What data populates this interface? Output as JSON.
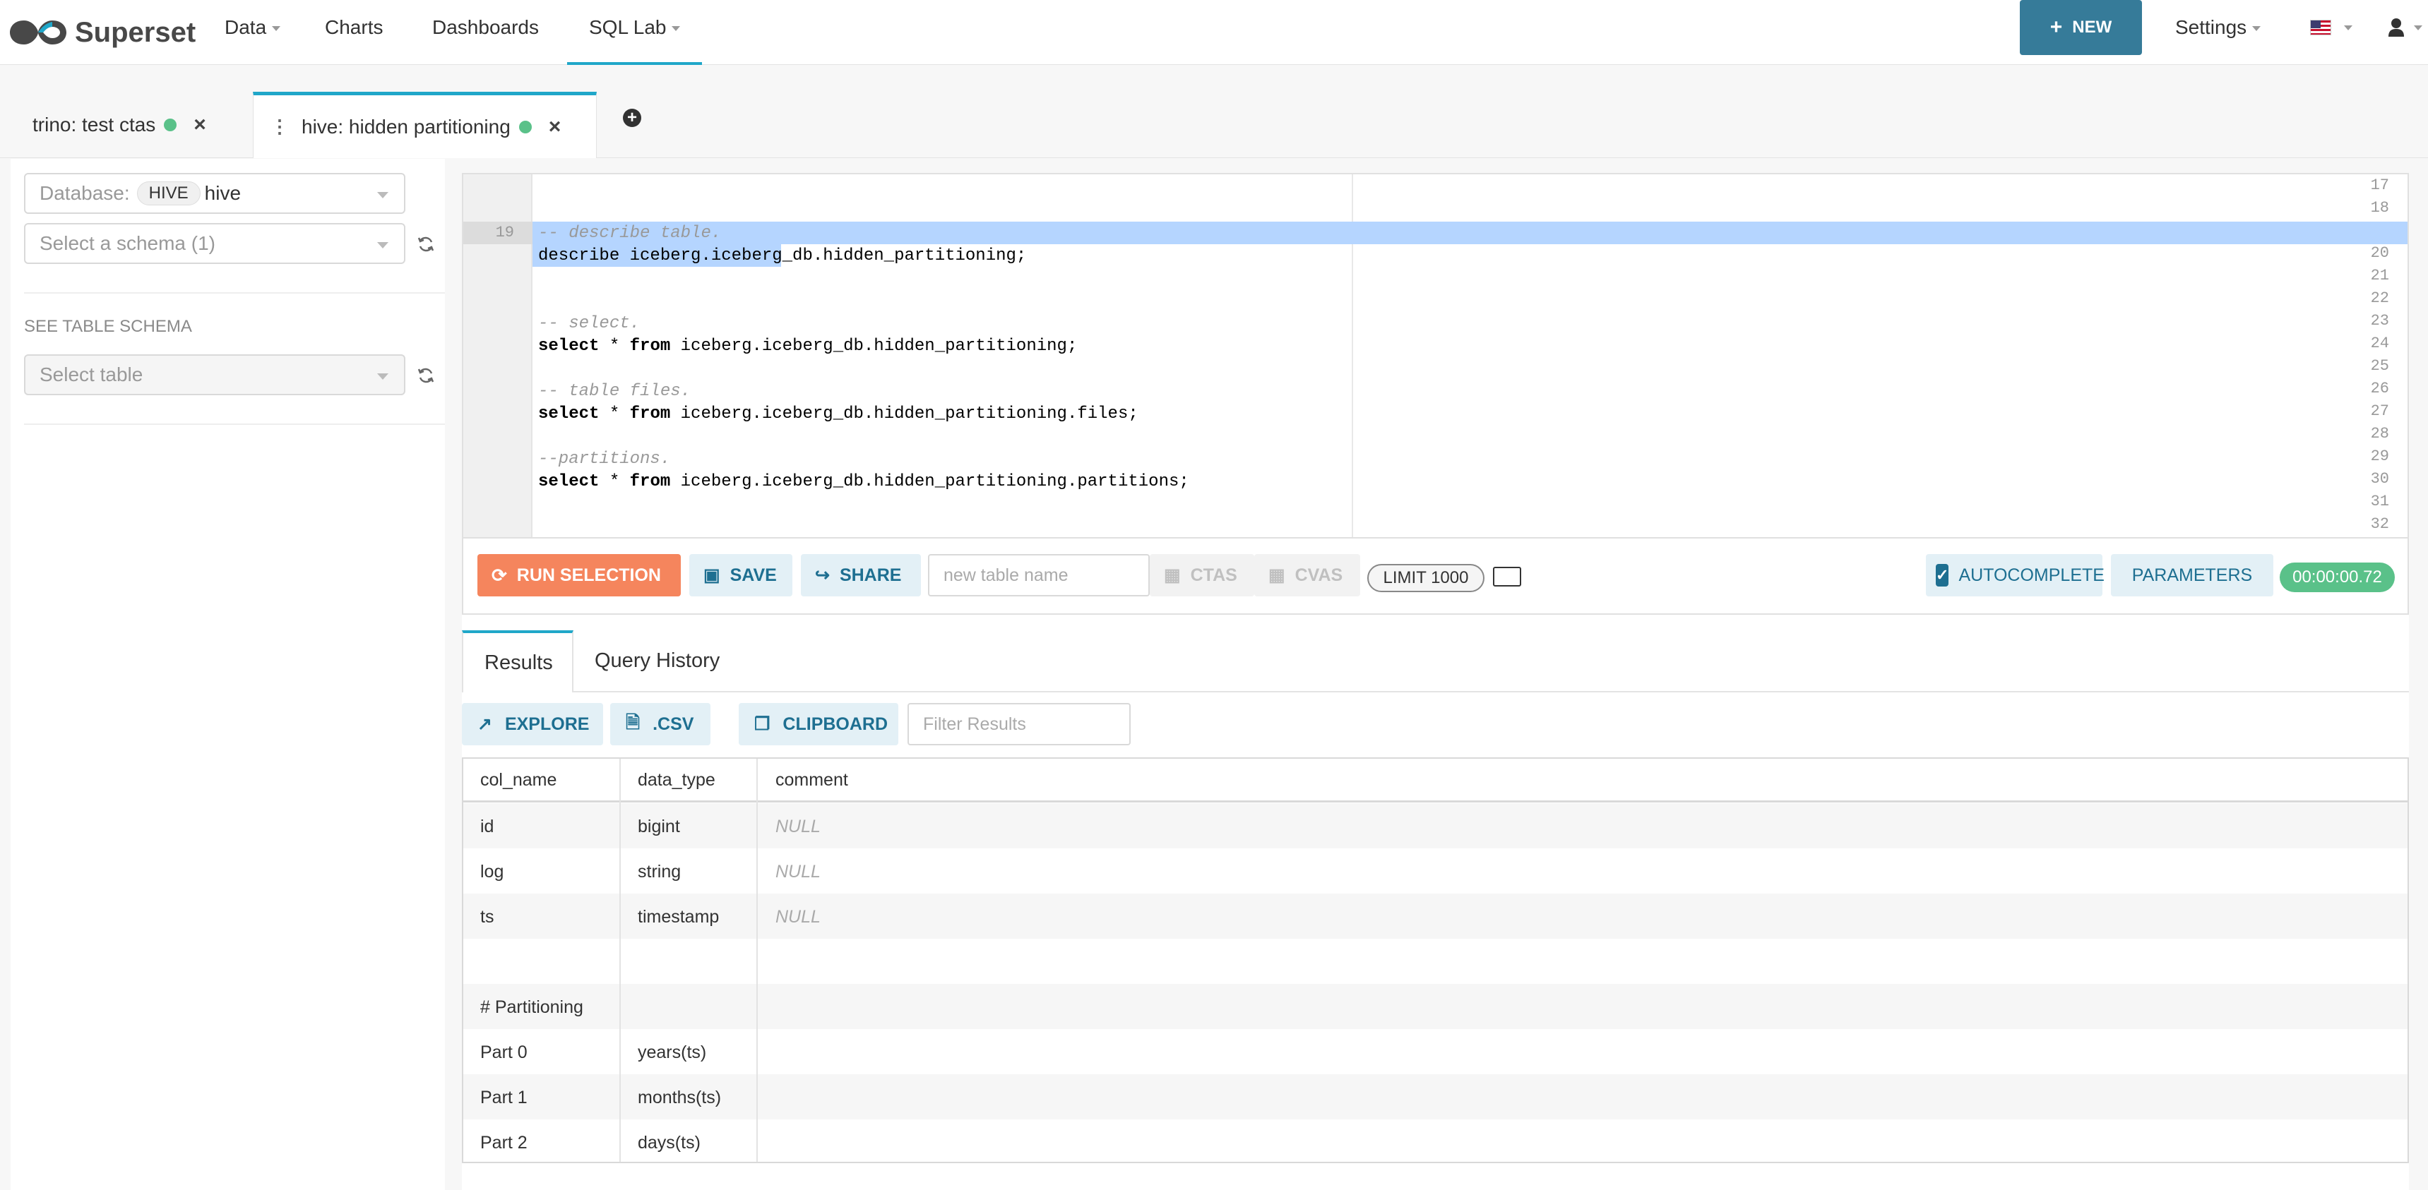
{
  "navbar": {
    "brand": "Superset",
    "items": [
      {
        "label": "Data",
        "dropdown": true
      },
      {
        "label": "Charts",
        "dropdown": false
      },
      {
        "label": "Dashboards",
        "dropdown": false
      },
      {
        "label": "SQL Lab",
        "dropdown": true,
        "active": true
      }
    ],
    "new_button": "NEW",
    "settings": "Settings",
    "language_icon": "us-flag-icon",
    "user_icon": "user-icon"
  },
  "query_tabs": [
    {
      "label": "trino: test ctas",
      "status": "success",
      "active": false
    },
    {
      "label": "hive: hidden partitioning",
      "status": "success",
      "active": true
    }
  ],
  "left_panel": {
    "database_label": "Database:",
    "database_tag": "HIVE",
    "database_value": "hive",
    "schema_placeholder": "Select a schema (1)",
    "section_label": "SEE TABLE SCHEMA",
    "table_placeholder": "Select table"
  },
  "editor": {
    "lines": [
      {
        "num": "17",
        "text": ""
      },
      {
        "num": "18",
        "text": ""
      },
      {
        "num": "19",
        "text": "-- describe table."
      },
      {
        "num": "20",
        "text": "describe iceberg.iceberg_db.hidden_partitioning;"
      },
      {
        "num": "21",
        "text": ""
      },
      {
        "num": "22",
        "text": ""
      },
      {
        "num": "23",
        "text": "-- select."
      },
      {
        "num": "24",
        "kw1": "select",
        "mid": " * ",
        "kw2": "from",
        "rest": " iceberg.iceberg_db.hidden_partitioning;"
      },
      {
        "num": "25",
        "text": ""
      },
      {
        "num": "26",
        "text": "-- table files."
      },
      {
        "num": "27",
        "kw1": "select",
        "mid": " * ",
        "kw2": "from",
        "rest": " iceberg.iceberg_db.hidden_partitioning.files;"
      },
      {
        "num": "28",
        "text": ""
      },
      {
        "num": "29",
        "text": "--partitions."
      },
      {
        "num": "30",
        "kw1": "select",
        "mid": " * ",
        "kw2": "from",
        "rest": " iceberg.iceberg_db.hidden_partitioning.partitions;"
      },
      {
        "num": "31",
        "text": ""
      },
      {
        "num": "32",
        "text": ""
      }
    ]
  },
  "toolbar": {
    "run": "RUN SELECTION",
    "save": "SAVE",
    "share": "SHARE",
    "table_name_placeholder": "new table name",
    "ctas": "CTAS",
    "cvas": "CVAS",
    "limit": "LIMIT 1000",
    "autocomplete": "AUTOCOMPLETE",
    "parameters": "PARAMETERS",
    "timer": "00:00:00.72"
  },
  "results": {
    "tabs": [
      "Results",
      "Query History"
    ],
    "explore": "EXPLORE",
    "csv": ".CSV",
    "clipboard": "CLIPBOARD",
    "filter_placeholder": "Filter Results",
    "columns": [
      "col_name",
      "data_type",
      "comment"
    ],
    "rows": [
      [
        "id",
        "bigint",
        "NULL"
      ],
      [
        "log",
        "string",
        "NULL"
      ],
      [
        "ts",
        "timestamp",
        "NULL"
      ],
      [
        "",
        "",
        ""
      ],
      [
        "# Partitioning",
        "",
        ""
      ],
      [
        "Part 0",
        "years(ts)",
        ""
      ],
      [
        "Part 1",
        "months(ts)",
        ""
      ],
      [
        "Part 2",
        "days(ts)",
        ""
      ]
    ]
  },
  "colors": {
    "accent": "#20a7c9",
    "primary_button": "#f5855d",
    "secondary_button": "#e3f0f6",
    "new_button": "#367b99",
    "success": "#5ac189",
    "selection": "#b5d5ff"
  }
}
